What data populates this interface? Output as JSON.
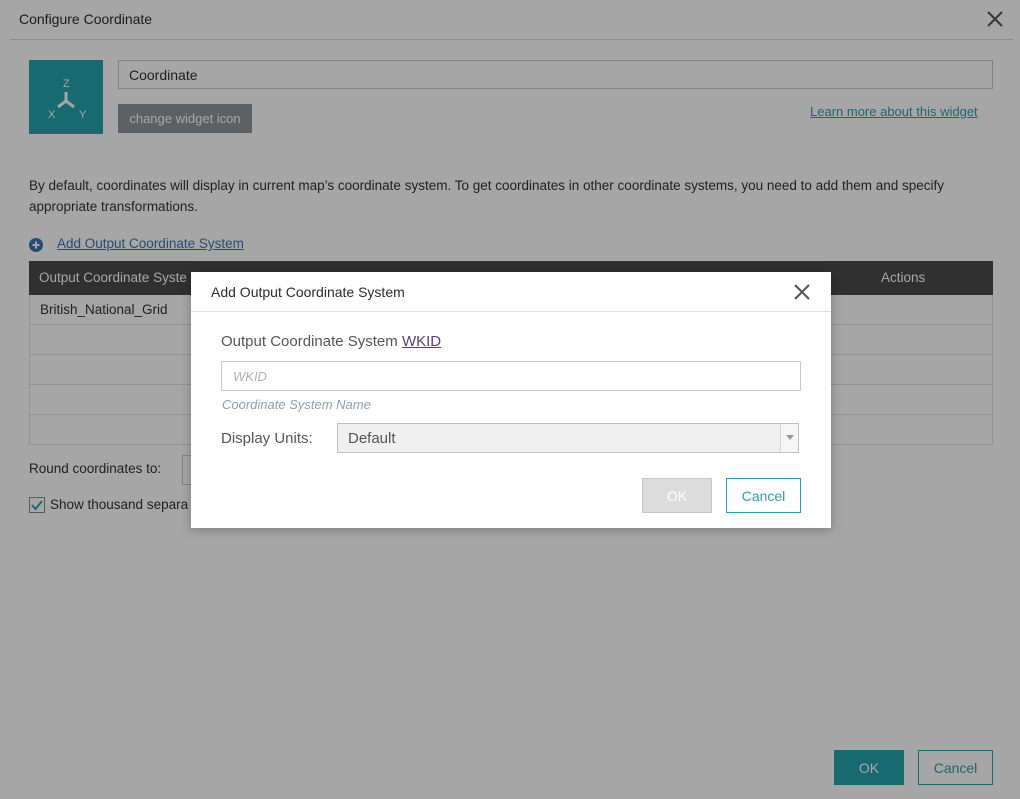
{
  "panel": {
    "title": "Configure Coordinate",
    "widget_name": "Coordinate",
    "change_icon_label": "change widget icon",
    "learn_more_label": "Learn more about this widget",
    "description": "By default, coordinates will display in current map’s coordinate system. To get coordinates in other coordinate systems, you need to add them and specify appropriate transformations.",
    "add_ocs_label": "Add Output Coordinate System",
    "table": {
      "headers": [
        "Output Coordinate Syste",
        "Actions"
      ],
      "rows": [
        "British_National_Grid",
        "",
        "",
        "",
        ""
      ]
    },
    "round_label": "Round coordinates to:",
    "thousand_label": "Show thousand separa",
    "thousand_checked": true,
    "ok_label": "OK",
    "cancel_label": "Cancel"
  },
  "dialog": {
    "title": "Add Output Coordinate System",
    "ocs_label_prefix": "Output Coordinate System",
    "wkid_link": "WKID",
    "wkid_placeholder": "WKID",
    "cs_name_label": "Coordinate System Name",
    "units_label": "Display Units:",
    "units_value": "Default",
    "ok_label": "OK",
    "cancel_label": "Cancel"
  },
  "colors": {
    "accent": "#24a3ab",
    "header_dark": "#4a4a4a",
    "link_blue": "#3a76b6",
    "wkid_link": "#5c3b8e"
  },
  "icons": {
    "widget_icon": "xyz-axes-icon",
    "add": "plus-circle-icon",
    "close": "close-icon",
    "dropdown": "chevron-down-icon",
    "check": "checkmark-icon"
  }
}
